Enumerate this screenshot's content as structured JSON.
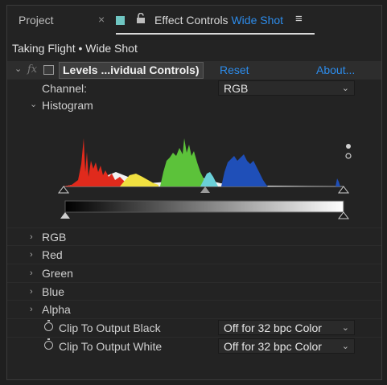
{
  "tabs": {
    "project_label": "Project",
    "close_glyph": "×",
    "effect_controls_prefix": "Effect Controls",
    "effect_controls_layer": "Wide Shot",
    "menu_glyph": "≡",
    "lock_glyph": "🔓"
  },
  "composition": {
    "title": "Taking Flight • Wide Shot"
  },
  "effect": {
    "fx_badge": "fx",
    "name": "Levels ...ividual Controls)",
    "reset_label": "Reset",
    "about_label": "About..."
  },
  "properties": {
    "channel_label": "Channel:",
    "channel_value": "RGB",
    "histogram_label": "Histogram",
    "rgb_label": "RGB",
    "red_label": "Red",
    "green_label": "Green",
    "blue_label": "Blue",
    "alpha_label": "Alpha",
    "clip_black_label": "Clip To Output Black",
    "clip_black_value": "Off for 32 bpc Color",
    "clip_white_label": "Clip To Output White",
    "clip_white_value": "Off for 32 bpc Color"
  },
  "colors": {
    "accent": "#2d8ceb",
    "histogram_red": "#e02a1c",
    "histogram_green": "#5cc23a",
    "histogram_blue": "#1f4fb8",
    "histogram_yellow": "#f0e040",
    "histogram_cyan": "#6ad0d8"
  }
}
